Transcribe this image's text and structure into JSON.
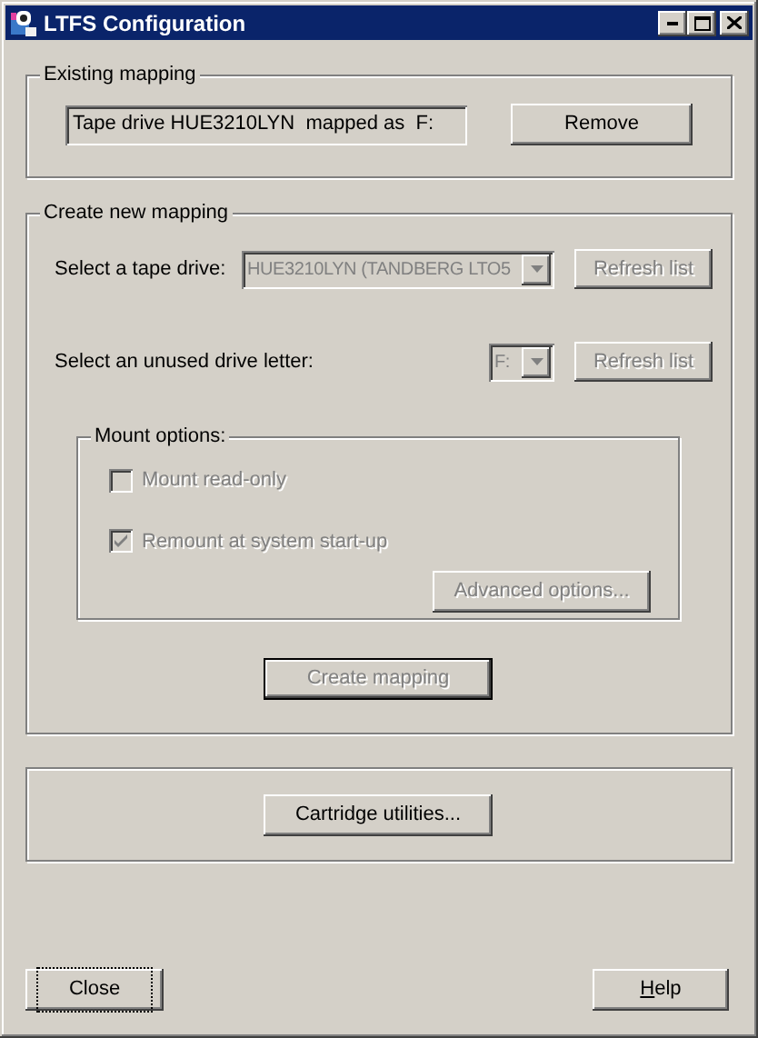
{
  "window": {
    "title": "LTFS Configuration"
  },
  "existing_mapping": {
    "title": "Existing mapping",
    "value": "Tape drive HUE3210LYN  mapped as  F:",
    "remove_button": {
      "label": "Remove",
      "disabled": false
    }
  },
  "create_new_mapping": {
    "title": "Create new mapping",
    "tape_drive": {
      "label": "Select a tape drive:",
      "value": "HUE3210LYN (TANDBERG LTO5",
      "disabled": true,
      "refresh": {
        "label": "Refresh list",
        "disabled": true
      }
    },
    "drive_letter": {
      "label": "Select an unused drive letter:",
      "value": "F:",
      "disabled": true,
      "refresh": {
        "label": "Refresh list",
        "disabled": true
      }
    },
    "mount_options": {
      "title": "Mount options:",
      "options": [
        {
          "label": "Mount read-only",
          "checked": false,
          "disabled": true
        },
        {
          "label": "Remount at system start-up",
          "checked": true,
          "disabled": true
        }
      ],
      "advanced_button": {
        "label": "Advanced options...",
        "disabled": true
      }
    },
    "create_button": {
      "label": "Create mapping",
      "disabled": true,
      "default": true
    }
  },
  "cartridge_button": {
    "label": "Cartridge utilities...",
    "disabled": false
  },
  "buttons": [
    {
      "label_parts": [
        {
          "text": "Close",
          "underlined": false
        }
      ],
      "focused": true
    },
    {
      "label_parts": [
        {
          "text": "H",
          "underlined": true
        },
        {
          "text": "elp",
          "underlined": false
        }
      ],
      "focused": false
    }
  ]
}
